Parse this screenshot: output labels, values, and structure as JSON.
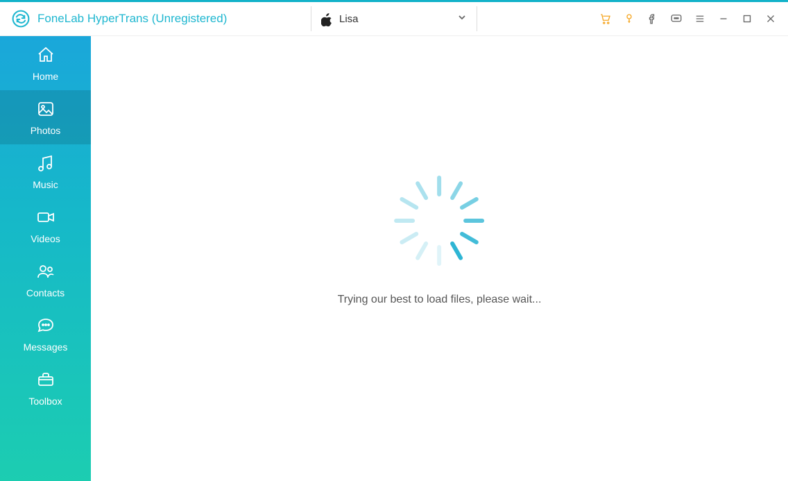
{
  "header": {
    "title": "FoneLab HyperTrans (Unregistered)",
    "device": {
      "name": "Lisa",
      "platform_icon": "apple-icon"
    },
    "actions": {
      "cart_icon": "cart-icon",
      "key_icon": "key-icon",
      "facebook_icon": "facebook-icon",
      "feedback_icon": "feedback-icon",
      "menu_icon": "menu-icon",
      "minimize_icon": "minimize-icon",
      "maximize_icon": "maximize-icon",
      "close_icon": "close-icon"
    }
  },
  "sidebar": {
    "items": [
      {
        "label": "Home",
        "icon": "home-icon",
        "active": false
      },
      {
        "label": "Photos",
        "icon": "photos-icon",
        "active": true
      },
      {
        "label": "Music",
        "icon": "music-icon",
        "active": false
      },
      {
        "label": "Videos",
        "icon": "videos-icon",
        "active": false
      },
      {
        "label": "Contacts",
        "icon": "contacts-icon",
        "active": false
      },
      {
        "label": "Messages",
        "icon": "messages-icon",
        "active": false
      },
      {
        "label": "Toolbox",
        "icon": "toolbox-icon",
        "active": false
      }
    ]
  },
  "main": {
    "loading_text": "Trying our best to load files, please wait..."
  },
  "colors": {
    "accent": "#1fb7d0",
    "sidebar_gradient_top": "#1aa7da",
    "sidebar_gradient_bottom": "#1ccdb1",
    "action_highlight": "#f5a623"
  }
}
